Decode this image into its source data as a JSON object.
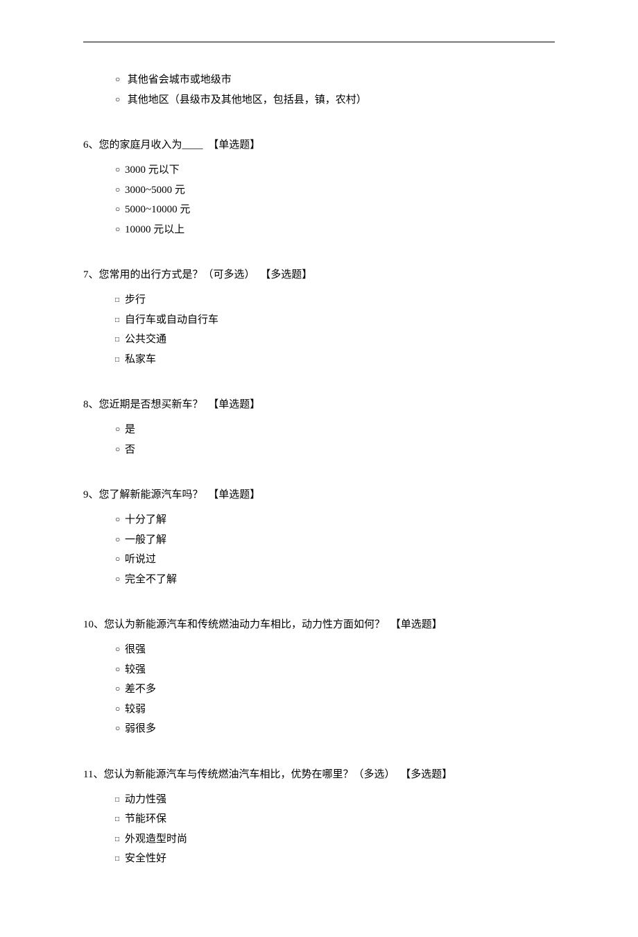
{
  "orphan_options": [
    "其他省会城市或地级市",
    "其他地区（县级市及其他地区，包括县，镇，农村）"
  ],
  "questions": [
    {
      "num": "6、",
      "text": "您的家庭月收入为____",
      "tag": "【单选题】",
      "single": true,
      "options": [
        "3000 元以下",
        "3000~5000 元",
        "5000~10000 元",
        "10000 元以上"
      ]
    },
    {
      "num": "7、",
      "text": "您常用的出行方式是？（可多选）",
      "tag": "【多选题】",
      "single": false,
      "options": [
        "步行",
        "自行车或自动自行车",
        "公共交通",
        "私家车"
      ]
    },
    {
      "num": "8、",
      "text": "您近期是否想买新车？",
      "tag": "【单选题】",
      "single": true,
      "options": [
        "是",
        "否"
      ]
    },
    {
      "num": "9、",
      "text": "您了解新能源汽车吗？",
      "tag": "【单选题】",
      "single": true,
      "options": [
        "十分了解",
        "一般了解",
        "听说过",
        "完全不了解"
      ]
    },
    {
      "num": "10、",
      "text": "您认为新能源汽车和传统燃油动力车相比，动力性方面如何？",
      "tag": "【单选题】",
      "single": true,
      "options": [
        "很强",
        "较强",
        "差不多",
        "较弱",
        "弱很多"
      ]
    },
    {
      "num": "11、",
      "text": "您认为新能源汽车与传统燃油汽车相比，优势在哪里？（多选）",
      "tag": "【多选题】",
      "single": false,
      "options": [
        "动力性强",
        "节能环保",
        "外观造型时尚",
        "安全性好"
      ]
    }
  ]
}
